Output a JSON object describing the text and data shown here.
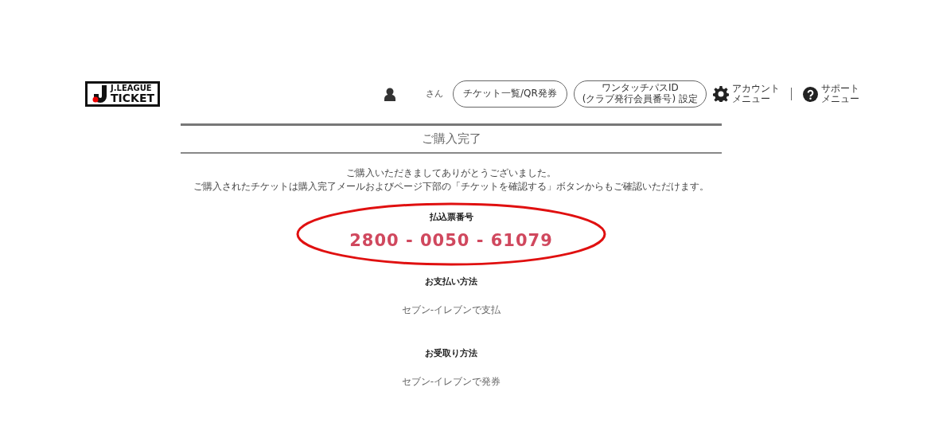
{
  "logo": {
    "line_1": "J.LEAGUE",
    "line_2": "TICKET"
  },
  "header": {
    "user_suffix": "さん",
    "nav_buttons": [
      {
        "lines": [
          "チケット一覧/QR発券"
        ]
      },
      {
        "lines": [
          "ワンタッチパスID",
          "(クラブ発行会員番号) 設定"
        ]
      }
    ],
    "menus": [
      {
        "kind": "gear",
        "lines": [
          "アカウント",
          "メニュー"
        ]
      },
      {
        "kind": "help",
        "lines": [
          "サポート",
          "メニュー"
        ]
      }
    ]
  },
  "title": "ご購入完了",
  "message": [
    "ご購入いただきましてありがとうございました。",
    "ご購入されたチケットは購入完了メールおよびページ下部の「チケットを確認する」ボタンからもご確認いただけます。"
  ],
  "sections": [
    {
      "kind": "number",
      "heading": "払込票番号",
      "value": "2800 - 0050 - 61079",
      "highlighted": true
    },
    {
      "kind": "text",
      "heading": "お支払い方法",
      "value": "セブン-イレブンで支払"
    },
    {
      "kind": "text",
      "heading": "お受取り方法",
      "value": "セブン-イレブンで発券"
    }
  ]
}
